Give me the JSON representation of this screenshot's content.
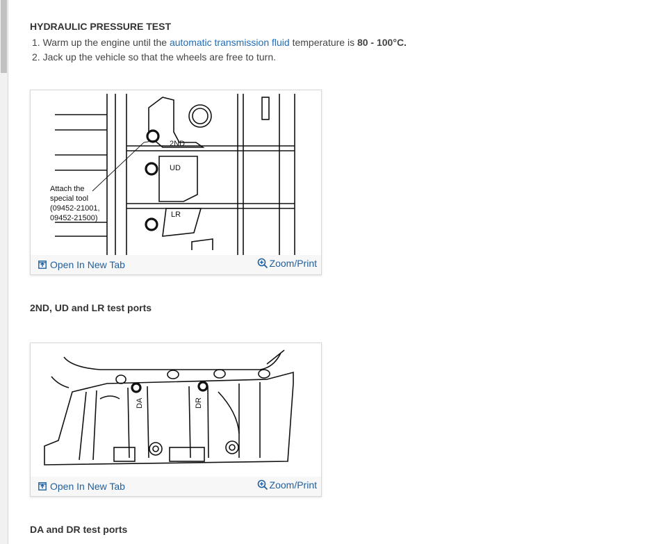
{
  "section": {
    "title": "HYDRAULIC PRESSURE TEST",
    "steps": [
      {
        "number": "1.",
        "before": "Warm up the engine until the",
        "link": "automatic transmission fluid",
        "after": "temperature is",
        "value": "80 - 100°C."
      },
      {
        "number": "2.",
        "text": "Jack up the vehicle so that the wheels are free to turn."
      }
    ]
  },
  "figures": [
    {
      "caption": "2ND, UD and LR test ports",
      "open_label": "Open In New Tab",
      "zoom_label": "Zoom/Print",
      "labels": {
        "port_2nd": "2ND",
        "port_ud": "UD",
        "port_lr": "LR",
        "callout": [
          "Attach the",
          "special tool",
          "(09452-21001,",
          "09452-21500)"
        ]
      }
    },
    {
      "caption": "DA and DR test ports",
      "open_label": "Open In New Tab",
      "zoom_label": "Zoom/Print",
      "labels": {
        "port_da": "DA",
        "port_dr": "DR"
      }
    }
  ],
  "colors": {
    "link": "#1f6db5",
    "toolbar_text": "#1f5f9e"
  }
}
